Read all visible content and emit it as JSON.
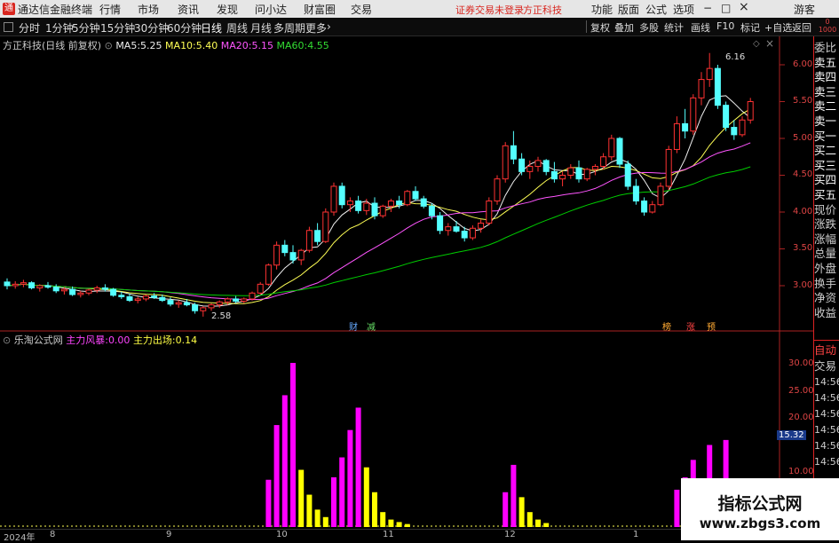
{
  "titlebar": {
    "app_name": "通达信金融终端",
    "menus": [
      "行情",
      "市场",
      "资讯",
      "发现",
      "问小达",
      "财富圈",
      "交易"
    ],
    "notice_left": "证券交易未登录",
    "notice_right": "方正科技",
    "right_menus": [
      "功能",
      "版面",
      "公式",
      "选项"
    ],
    "guest": "游客",
    "minimize": "−",
    "maximize": "□",
    "close": "×"
  },
  "periods": [
    "分时",
    "1分钟",
    "5分钟",
    "15分钟",
    "30分钟",
    "60分钟",
    "日线",
    "周线",
    "月线",
    "多周期",
    "更多"
  ],
  "active_period": "日线",
  "toolbar_right": [
    "复权",
    "叠加",
    "多股",
    "统计",
    "画线",
    "F10",
    "标记",
    "+自选",
    "返回"
  ],
  "main_header": {
    "stock": "方正科技(日线 前复权)",
    "ma5_label": "MA5:",
    "ma5": "5.25",
    "ma10_label": "MA10:",
    "ma10": "5.40",
    "ma20_label": "MA20:",
    "ma20": "5.15",
    "ma60_label": "MA60:",
    "ma60": "4.55"
  },
  "price_axis": [
    "6.00",
    "5.50",
    "5.00",
    "4.50",
    "4.00",
    "3.50",
    "3.00"
  ],
  "high_label": "6.16",
  "low_label": "2.58",
  "event_tags": [
    "财",
    "减",
    "榜",
    "涨",
    "预"
  ],
  "indicator_header": {
    "name": "乐淘公式网",
    "fengbao_label": "主力风暴:",
    "fengbao": "0.00",
    "chuchang_label": "主力出场:",
    "chuchang": "0.14"
  },
  "ind_axis": [
    "30.00",
    "25.00",
    "20.00",
    "15.00",
    "10.00"
  ],
  "ind_marker": "15.32",
  "date_axis": [
    "2024年",
    "8",
    "9",
    "10",
    "11",
    "12",
    "1"
  ],
  "side_labels": [
    "委比",
    "卖五",
    "卖四",
    "卖三",
    "卖二",
    "卖一",
    "买一",
    "买二",
    "买三",
    "买四",
    "买五",
    "现价",
    "涨跌",
    "涨幅",
    "总量",
    "外盘",
    "换手",
    "净资",
    "收益"
  ],
  "side_bottom": [
    "自动",
    "交易",
    "14:56",
    "14:56",
    "14:56",
    "14:56",
    "14:56",
    "14:56",
    "14:56",
    "14:56"
  ],
  "side_top_small": "0\n1000",
  "watermark_title": "指标公式网",
  "watermark_url": "www.zbgs3.com",
  "colors": {
    "up": "#ff3232",
    "down": "#54ffff",
    "ma5": "#f0f0f0",
    "ma10": "#ffff55",
    "ma20": "#ff55ff",
    "ma60": "#00cc00",
    "fengbao": "#ff00ff",
    "chuchang": "#ffff00"
  },
  "chart_data": {
    "type": "candlestick",
    "ylim": [
      2.4,
      6.4
    ],
    "ohlc": [
      [
        3.05,
        3.1,
        2.95,
        3.0
      ],
      [
        3.0,
        3.06,
        2.96,
        3.02
      ],
      [
        3.02,
        3.08,
        2.98,
        3.04
      ],
      [
        3.04,
        3.06,
        2.95,
        2.97
      ],
      [
        2.97,
        3.02,
        2.92,
        3.0
      ],
      [
        3.0,
        3.05,
        2.96,
        2.98
      ],
      [
        2.98,
        3.02,
        2.9,
        2.93
      ],
      [
        2.93,
        2.98,
        2.88,
        2.95
      ],
      [
        2.95,
        2.99,
        2.86,
        2.88
      ],
      [
        2.88,
        2.93,
        2.84,
        2.9
      ],
      [
        2.9,
        2.96,
        2.87,
        2.94
      ],
      [
        2.94,
        3.0,
        2.9,
        2.97
      ],
      [
        2.97,
        3.02,
        2.92,
        2.95
      ],
      [
        2.95,
        2.97,
        2.85,
        2.87
      ],
      [
        2.87,
        2.92,
        2.82,
        2.85
      ],
      [
        2.85,
        2.89,
        2.78,
        2.8
      ],
      [
        2.8,
        2.85,
        2.76,
        2.82
      ],
      [
        2.82,
        2.88,
        2.79,
        2.86
      ],
      [
        2.86,
        2.9,
        2.82,
        2.84
      ],
      [
        2.84,
        2.88,
        2.78,
        2.8
      ],
      [
        2.8,
        2.84,
        2.72,
        2.75
      ],
      [
        2.75,
        2.8,
        2.7,
        2.77
      ],
      [
        2.77,
        2.82,
        2.72,
        2.74
      ],
      [
        2.74,
        2.77,
        2.62,
        2.66
      ],
      [
        2.66,
        2.72,
        2.58,
        2.7
      ],
      [
        2.7,
        2.76,
        2.66,
        2.74
      ],
      [
        2.74,
        2.8,
        2.7,
        2.78
      ],
      [
        2.78,
        2.84,
        2.74,
        2.82
      ],
      [
        2.82,
        2.86,
        2.76,
        2.79
      ],
      [
        2.79,
        2.84,
        2.76,
        2.82
      ],
      [
        2.82,
        2.92,
        2.8,
        2.9
      ],
      [
        2.9,
        3.05,
        2.88,
        3.02
      ],
      [
        3.02,
        3.3,
        3.0,
        3.28
      ],
      [
        3.28,
        3.6,
        3.22,
        3.55
      ],
      [
        3.55,
        3.62,
        3.4,
        3.45
      ],
      [
        3.45,
        3.55,
        3.3,
        3.35
      ],
      [
        3.35,
        3.5,
        3.28,
        3.48
      ],
      [
        3.48,
        3.8,
        3.45,
        3.75
      ],
      [
        3.75,
        3.85,
        3.55,
        3.6
      ],
      [
        3.6,
        4.05,
        3.58,
        4.0
      ],
      [
        4.0,
        4.4,
        3.95,
        4.35
      ],
      [
        4.35,
        4.4,
        4.05,
        4.1
      ],
      [
        4.1,
        4.2,
        4.0,
        4.15
      ],
      [
        4.15,
        4.22,
        3.98,
        4.02
      ],
      [
        4.02,
        4.18,
        3.96,
        4.12
      ],
      [
        4.12,
        4.2,
        3.9,
        3.95
      ],
      [
        3.95,
        4.1,
        3.92,
        4.08
      ],
      [
        4.08,
        4.18,
        4.0,
        4.15
      ],
      [
        4.15,
        4.22,
        4.05,
        4.1
      ],
      [
        4.1,
        4.3,
        4.08,
        4.28
      ],
      [
        4.28,
        4.35,
        4.15,
        4.18
      ],
      [
        4.18,
        4.22,
        4.05,
        4.08
      ],
      [
        4.08,
        4.12,
        3.9,
        3.95
      ],
      [
        3.95,
        4.0,
        3.7,
        3.75
      ],
      [
        3.75,
        3.85,
        3.68,
        3.8
      ],
      [
        3.8,
        3.88,
        3.72,
        3.74
      ],
      [
        3.74,
        3.8,
        3.6,
        3.65
      ],
      [
        3.65,
        3.82,
        3.62,
        3.78
      ],
      [
        3.78,
        3.9,
        3.72,
        3.85
      ],
      [
        3.85,
        4.2,
        3.82,
        4.15
      ],
      [
        4.15,
        4.5,
        4.1,
        4.45
      ],
      [
        4.45,
        4.95,
        4.4,
        4.9
      ],
      [
        4.9,
        5.1,
        4.65,
        4.72
      ],
      [
        4.72,
        4.8,
        4.5,
        4.55
      ],
      [
        4.55,
        4.7,
        4.45,
        4.62
      ],
      [
        4.62,
        4.75,
        4.55,
        4.7
      ],
      [
        4.7,
        4.72,
        4.5,
        4.55
      ],
      [
        4.55,
        4.68,
        4.4,
        4.45
      ],
      [
        4.45,
        4.55,
        4.35,
        4.5
      ],
      [
        4.5,
        4.65,
        4.45,
        4.6
      ],
      [
        4.6,
        4.7,
        4.4,
        4.45
      ],
      [
        4.45,
        4.6,
        4.42,
        4.58
      ],
      [
        4.58,
        4.65,
        4.5,
        4.62
      ],
      [
        4.62,
        4.8,
        4.58,
        4.75
      ],
      [
        4.75,
        5.05,
        4.7,
        5.0
      ],
      [
        5.0,
        5.02,
        4.6,
        4.65
      ],
      [
        4.65,
        4.7,
        4.3,
        4.35
      ],
      [
        4.35,
        4.45,
        4.1,
        4.15
      ],
      [
        4.15,
        4.2,
        3.95,
        4.0
      ],
      [
        4.0,
        4.15,
        3.98,
        4.1
      ],
      [
        4.1,
        4.4,
        4.08,
        4.35
      ],
      [
        4.35,
        4.9,
        4.3,
        4.85
      ],
      [
        4.85,
        5.3,
        4.8,
        5.2
      ],
      [
        5.2,
        5.4,
        5.0,
        5.1
      ],
      [
        5.1,
        5.6,
        5.05,
        5.55
      ],
      [
        5.55,
        5.9,
        5.45,
        5.8
      ],
      [
        5.8,
        6.16,
        5.7,
        5.95
      ],
      [
        5.95,
        6.0,
        5.4,
        5.45
      ],
      [
        5.45,
        5.5,
        5.1,
        5.15
      ],
      [
        5.15,
        5.25,
        4.98,
        5.05
      ],
      [
        5.05,
        5.3,
        5.02,
        5.25
      ],
      [
        5.25,
        5.55,
        5.2,
        5.5
      ]
    ],
    "fengbao": [
      0,
      0,
      0,
      0,
      0,
      0,
      0,
      0,
      0,
      0,
      0,
      0,
      0,
      0,
      0,
      0,
      0,
      0,
      0,
      0,
      0,
      0,
      0,
      0,
      0,
      0,
      0,
      0,
      0,
      0,
      0,
      0,
      0,
      0,
      0,
      0,
      0,
      0,
      0,
      0,
      0,
      0,
      0,
      0,
      0,
      0,
      0,
      0,
      0,
      0,
      0,
      0,
      0,
      0,
      0,
      0,
      0,
      0,
      0,
      0,
      0,
      0,
      0,
      0,
      0,
      0,
      0,
      0,
      0,
      0,
      0,
      0,
      0,
      0,
      0,
      0,
      0,
      0,
      0,
      0,
      0,
      0,
      0,
      0,
      0,
      0,
      0,
      0,
      0,
      0,
      0,
      0
    ],
    "bars": [
      {
        "i": 32,
        "v": 9.5,
        "c": "m"
      },
      {
        "i": 33,
        "v": 20.5,
        "c": "m"
      },
      {
        "i": 34,
        "v": 26.5,
        "c": "m"
      },
      {
        "i": 35,
        "v": 33.0,
        "c": "m"
      },
      {
        "i": 36,
        "v": 11.5,
        "c": "y"
      },
      {
        "i": 37,
        "v": 6.5,
        "c": "y"
      },
      {
        "i": 38,
        "v": 3.5,
        "c": "y"
      },
      {
        "i": 39,
        "v": 2.0,
        "c": "y"
      },
      {
        "i": 40,
        "v": 10.0,
        "c": "m"
      },
      {
        "i": 41,
        "v": 14.0,
        "c": "m"
      },
      {
        "i": 42,
        "v": 19.5,
        "c": "m"
      },
      {
        "i": 43,
        "v": 24.0,
        "c": "m"
      },
      {
        "i": 44,
        "v": 12.0,
        "c": "y"
      },
      {
        "i": 45,
        "v": 7.0,
        "c": "y"
      },
      {
        "i": 46,
        "v": 3.0,
        "c": "y"
      },
      {
        "i": 47,
        "v": 1.5,
        "c": "y"
      },
      {
        "i": 48,
        "v": 1.0,
        "c": "y"
      },
      {
        "i": 49,
        "v": 0.6,
        "c": "y"
      },
      {
        "i": 61,
        "v": 7.0,
        "c": "m"
      },
      {
        "i": 62,
        "v": 12.5,
        "c": "m"
      },
      {
        "i": 63,
        "v": 6.0,
        "c": "y"
      },
      {
        "i": 64,
        "v": 3.0,
        "c": "y"
      },
      {
        "i": 65,
        "v": 1.5,
        "c": "y"
      },
      {
        "i": 66,
        "v": 0.8,
        "c": "y"
      },
      {
        "i": 82,
        "v": 7.5,
        "c": "m"
      },
      {
        "i": 83,
        "v": 10.0,
        "c": "m"
      },
      {
        "i": 84,
        "v": 13.5,
        "c": "m"
      },
      {
        "i": 85,
        "v": 8.5,
        "c": "y"
      },
      {
        "i": 86,
        "v": 16.5,
        "c": "m"
      },
      {
        "i": 87,
        "v": 4.5,
        "c": "y"
      },
      {
        "i": 88,
        "v": 17.5,
        "c": "m"
      },
      {
        "i": 89,
        "v": 4.0,
        "c": "y"
      }
    ],
    "ind_ylim": [
      0,
      36
    ]
  }
}
